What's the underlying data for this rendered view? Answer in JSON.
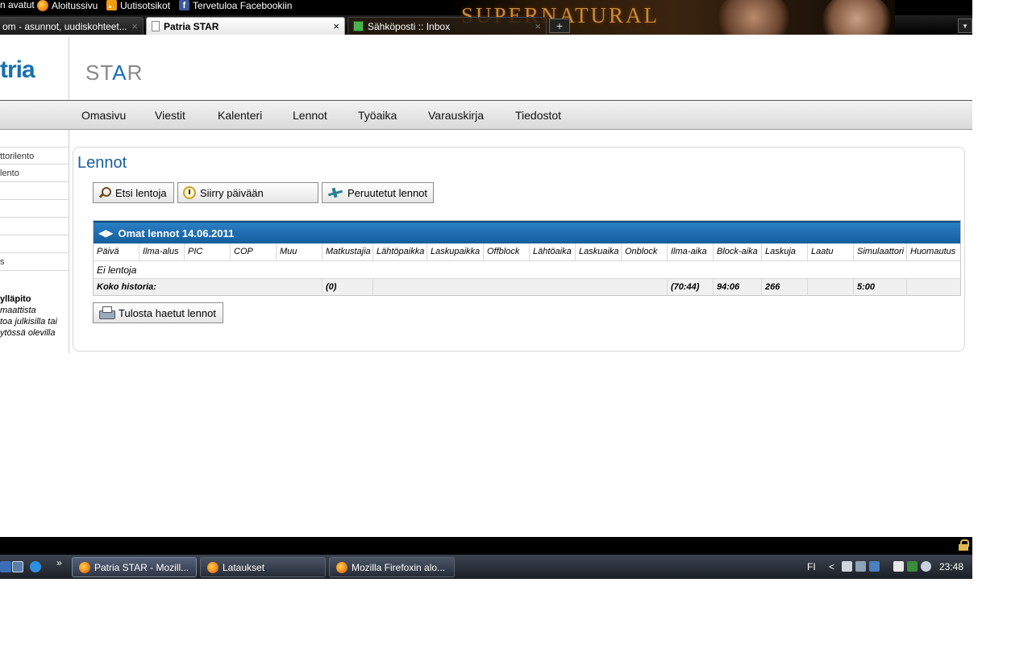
{
  "browser": {
    "bookmarks": [
      "n avatut",
      "Aloitussivu",
      "Uutisotsikot",
      "Tervetuloa Facebookiin"
    ],
    "tabs": [
      {
        "label": "om - asunnot, uudiskohteet...",
        "close": "×"
      },
      {
        "label": "Patria STAR",
        "close": "×"
      },
      {
        "label": "Sähköposti :: Inbox",
        "close": "×"
      }
    ],
    "new_tab": "+",
    "list_tabs": "▼",
    "banner_title": "SUPERNATURAL"
  },
  "header": {
    "logo": "tria",
    "star_logo_left": "ST",
    "star_logo_a": "A",
    "star_logo_right": "R"
  },
  "nav": [
    "Omasivu",
    "Viestit",
    "Kalenteri",
    "Lennot",
    "Työaika",
    "Varauskirja",
    "Tiedostot"
  ],
  "sidebar": {
    "items": [
      "ttorilento",
      "lento",
      "",
      "",
      "",
      "",
      "s"
    ],
    "box_title": "ylläpito",
    "box_lines": [
      "maattista",
      "toa julkisilla tai",
      "ytössä olevilla"
    ]
  },
  "main": {
    "title": "Lennot",
    "buttons": {
      "search": "Etsi lentoja",
      "goto_date": "Siirry päivään",
      "cancelled": "Peruutetut lennot",
      "print": "Tulosta haetut lennot"
    },
    "table": {
      "heading": "Omat lennot 14.06.2011",
      "columns": [
        "Päivä",
        "Ilma-alus",
        "PIC",
        "COP",
        "Muu",
        "Matkustajia",
        "Lähtöpaikka",
        "Laskupaikka",
        "Offblock",
        "Lähtöaika",
        "Laskuaika",
        "Onblock",
        "Ilma-aika",
        "Block-aika",
        "Laskuja",
        "Laatu",
        "Simulaattori",
        "Huomautus"
      ],
      "empty_text": "Ei lentoja",
      "total_label": "Koko historia:",
      "totals": {
        "passengers": "(0)",
        "air_time": "(70:44)",
        "block_time": "94:06",
        "landings": "266",
        "simulator": "5:00"
      }
    }
  },
  "taskbar": {
    "buttons": [
      "Patria STAR - Mozill...",
      "Lataukset",
      "Mozilla Firefoxin alo..."
    ],
    "chevron": "»",
    "lang": "FI",
    "tray_arrow": "<",
    "clock": "23:48"
  }
}
